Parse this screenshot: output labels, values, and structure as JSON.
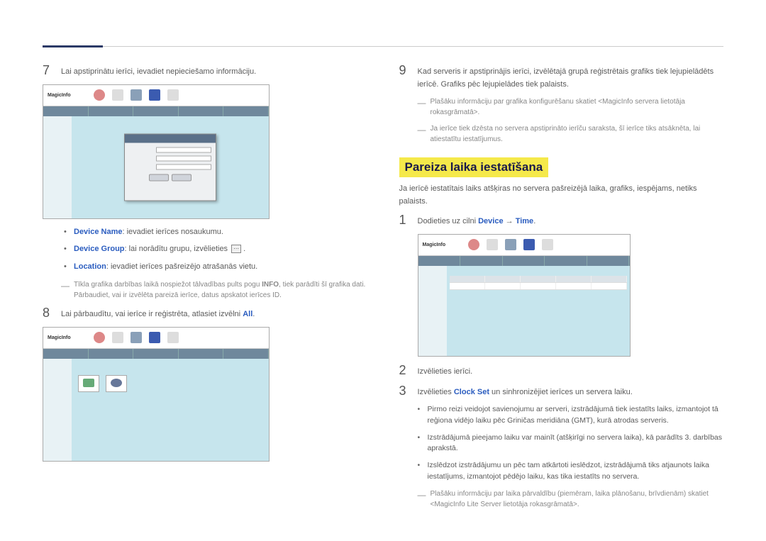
{
  "left": {
    "step7": {
      "num": "7",
      "text": "Lai apstiprinātu ierīci, ievadiet nepieciešamo informāciju."
    },
    "bullets": {
      "b1_label": "Device Name",
      "b1_text": ": ievadiet ierīces nosaukumu.",
      "b2_label": "Device Group",
      "b2_text": ": lai norādītu grupu, izvēlieties",
      "b3_label": "Location",
      "b3_text": ": ievadiet ierīces pašreizējo atrašanās vietu."
    },
    "note1_pre": "Tīkla grafika darbības laikā nospiežot tālvadības pults pogu ",
    "note1_bold": "INFO",
    "note1_post": ", tiek parādīti šī grafika dati. Pārbaudiet, vai ir izvēlēta pareizā ierīce, datus apskatot ierīces ID.",
    "step8": {
      "num": "8",
      "text_pre": "Lai pārbaudītu, vai ierīce ir reģistrēta, atlasiet izvēlni ",
      "all": "All",
      "dot": "."
    }
  },
  "right": {
    "step9": {
      "num": "9",
      "text": "Kad serveris ir apstiprinājis ierīci, izvēlētajā grupā reģistrētais grafiks tiek lejupielādēts ierīcē. Grafiks pēc lejupielādes tiek palaists."
    },
    "note_a": "Plašāku informāciju par grafika konfigurēšanu skatiet <MagicInfo servera lietotāja rokasgrāmatā>.",
    "note_b": "Ja ierīce tiek dzēsta no servera apstiprināto ierīču saraksta, šī ierīce tiks atsāknēta, lai atiestatītu iestatījumus.",
    "section_title": "Pareiza laika iestatīšana",
    "section_intro": "Ja ierīcē iestatītais laiks atšķiras no servera pašreizējā laika, grafiks, iespējams, netiks palaists.",
    "step1": {
      "num": "1",
      "pre": "Dodieties uz cilni ",
      "device": "Device",
      "arrow": " → ",
      "time": "Time",
      "dot": "."
    },
    "step2": {
      "num": "2",
      "text": "Izvēlieties ierīci."
    },
    "step3": {
      "num": "3",
      "pre": "Izvēlieties ",
      "clock": "Clock Set",
      "post": " un sinhronizējiet ierīces un servera laiku."
    },
    "sub1": "Pirmo reizi veidojot savienojumu ar serveri, izstrādājumā tiek iestatīts laiks, izmantojot tā reģiona vidējo laiku pēc Griničas meridiāna (GMT), kurā atrodas serveris.",
    "sub2": "Izstrādājumā pieejamo laiku var mainīt (atšķirīgi no servera laika), kā parādīts 3. darbības aprakstā.",
    "sub3": "Izslēdzot izstrādājumu un pēc tam atkārtoti ieslēdzot, izstrādājumā tiks atjaunots laika iestatījums, izmantojot pēdējo laiku, kas tika iestatīts no servera.",
    "note_c": "Plašāku informāciju par laika pārvaldību (piemēram, laika plānošanu, brīvdienām) skatiet <MagicInfo Lite Server lietotāja rokasgrāmatā>."
  },
  "ss": {
    "logo": "MagicInfo"
  }
}
